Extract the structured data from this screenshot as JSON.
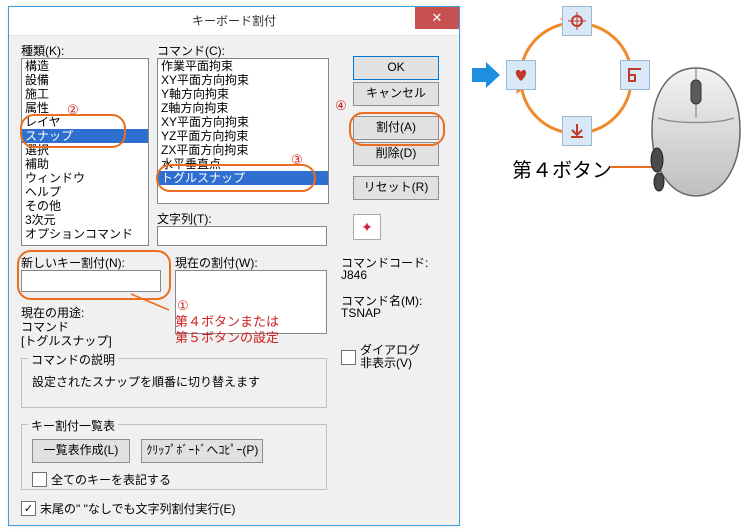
{
  "dialog": {
    "title": "キーボード割付",
    "close_x": "✕"
  },
  "labels": {
    "kind": "種類(K):",
    "command": "コマンド(C):",
    "string": "文字列(T):",
    "new_assign": "新しいキー割付(N):",
    "current_assign": "現在の割付(W):",
    "current_use": "現在の用途:",
    "cmd_desc_title": "コマンドの説明",
    "keylist_title": "キー割付一覧表",
    "cmd_code_label": "コマンドコード:",
    "cmd_name_label": "コマンド名(M):"
  },
  "lists": {
    "kind": [
      "構造",
      "設備",
      "施工",
      "属性",
      "レイヤ",
      "スナップ",
      "選択",
      "補助",
      "ウィンドウ",
      "ヘルプ",
      "その他",
      "3次元",
      "オプションコマンド"
    ],
    "kind_selected_index": 5,
    "command": [
      "作業平面拘束",
      "XY平面方向拘束",
      "Y軸方向拘束",
      "Z軸方向拘束",
      "XY平面方向拘束",
      "YZ平面方向拘束",
      "ZX平面方向拘束",
      "水平垂直点",
      "トグルスナップ"
    ],
    "command_selected_index": 8
  },
  "values": {
    "string_field": "",
    "new_assign_field": "",
    "current_assign_field": "",
    "current_use_cmd_label": "コマンド",
    "current_use_cmd_value": "[トグルスナップ]",
    "cmd_desc_text": "設定されたスナップを順番に切り替えます",
    "cmd_code_value": "J846",
    "cmd_name_value": "TSNAP",
    "hide_dialog_checked": false,
    "show_all_keys_checked": false,
    "exec_no_quotes_checked": true
  },
  "buttons": {
    "ok": "OK",
    "cancel": "キャンセル",
    "assign": "割付(A)",
    "delete": "削除(D)",
    "reset": "リセット(R)",
    "make_table": "一覧表作成(L)",
    "copy_clipboard": "ｸﾘｯﾌﾟﾎﾞｰﾄﾞへｺﾋﾟｰ(P)"
  },
  "checkboxes": {
    "hide_dialog": "ダイアログ\n非表示(V)",
    "show_all_keys": "全てのキーを表記する",
    "exec_no_quotes": "末尾の\" \"なしでも文字列割付実行(E)"
  },
  "callouts": {
    "n1": "①",
    "n2": "②",
    "n3": "③",
    "n4": "④",
    "note_line1": "第４ボタンまたは",
    "note_line2": "第５ボタンの設定"
  },
  "illus": {
    "big_label": "第４ボタン"
  }
}
